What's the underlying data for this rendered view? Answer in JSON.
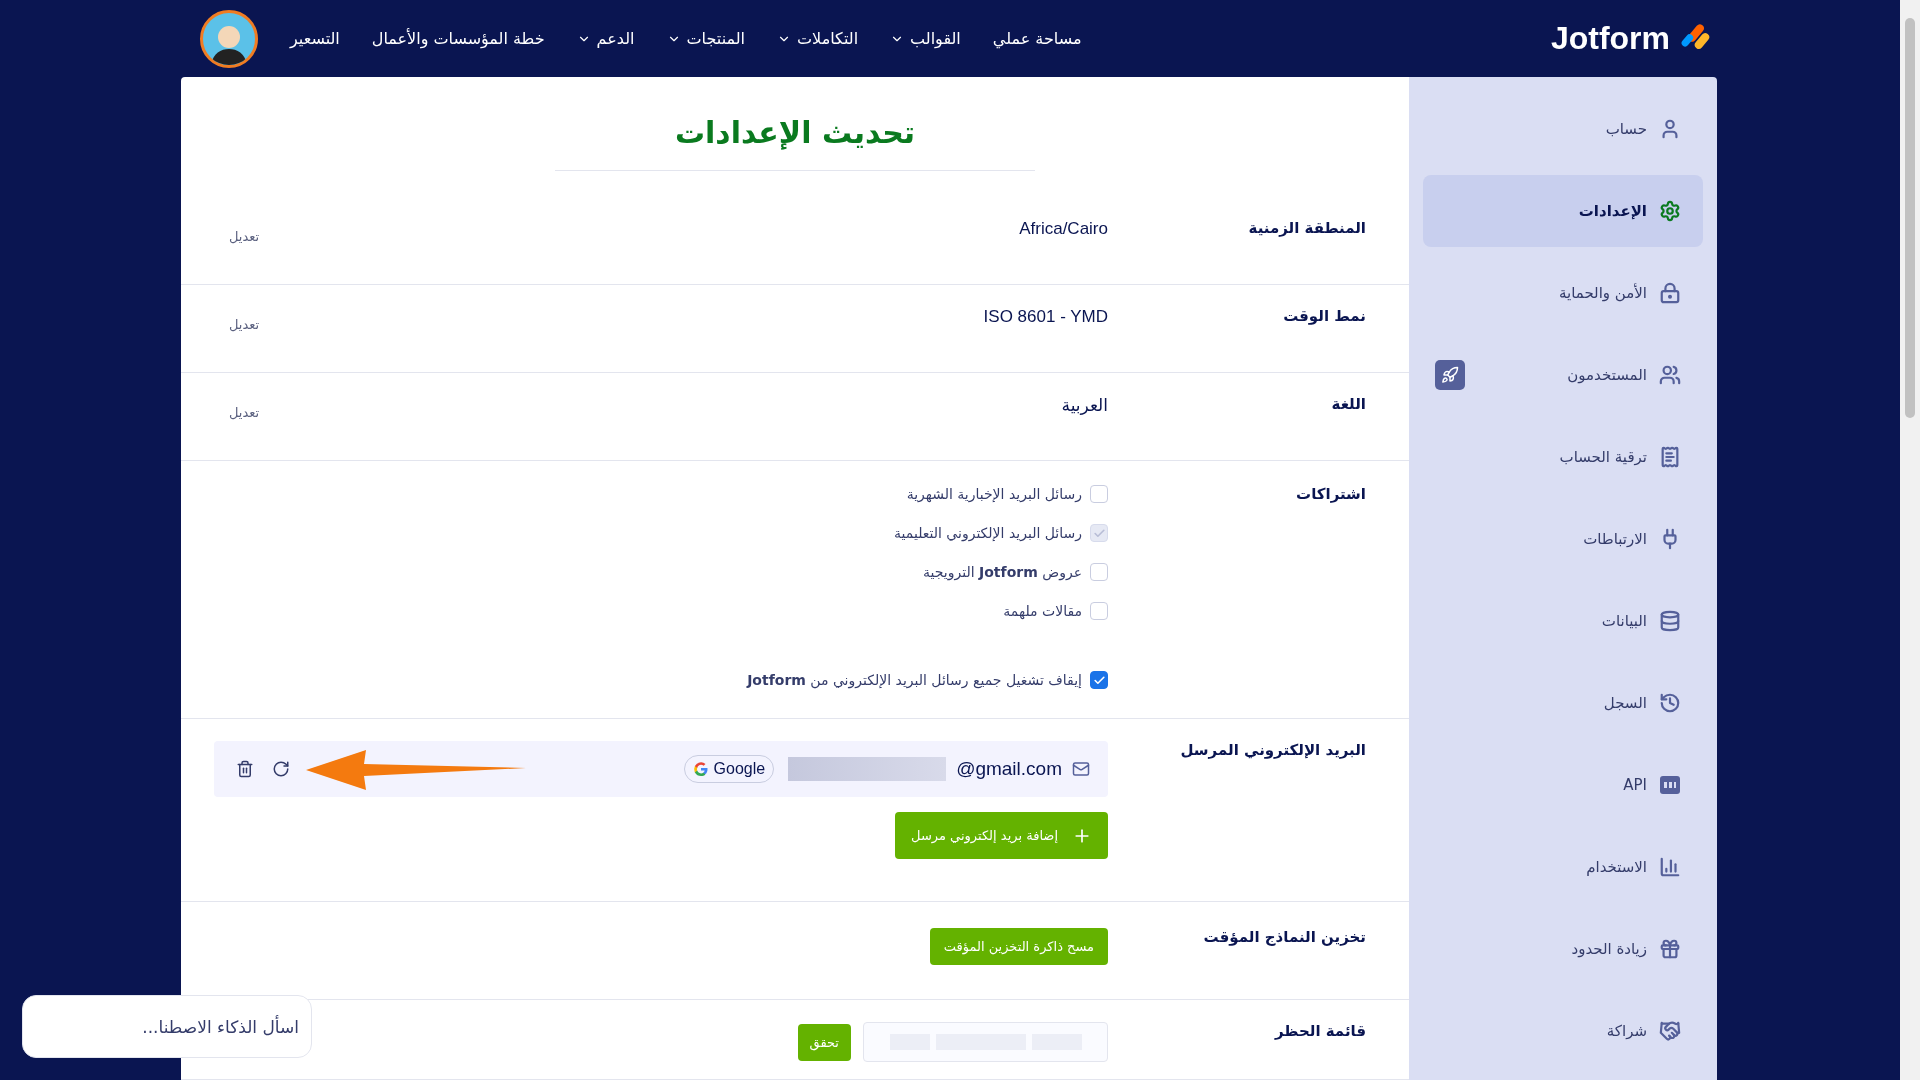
{
  "nav": {
    "logo": "Jotform",
    "items": [
      {
        "label": "مساحة عملي",
        "dropdown": false
      },
      {
        "label": "القوالب",
        "dropdown": true
      },
      {
        "label": "التكاملات",
        "dropdown": true
      },
      {
        "label": "المنتجات",
        "dropdown": true
      },
      {
        "label": "الدعم",
        "dropdown": true
      },
      {
        "label": "خطة المؤسسات والأعمال",
        "dropdown": false
      },
      {
        "label": "التسعير",
        "dropdown": false
      }
    ]
  },
  "sidebar": {
    "items": [
      {
        "label": "حساب",
        "selected": false
      },
      {
        "label": "الإعدادات",
        "selected": true
      },
      {
        "label": "الأمن والحماية",
        "selected": false
      },
      {
        "label": "المستخدمون",
        "selected": false
      },
      {
        "label": "ترقية الحساب",
        "selected": false
      },
      {
        "label": "الارتباطات",
        "selected": false
      },
      {
        "label": "البيانات",
        "selected": false
      },
      {
        "label": "السجل",
        "selected": false
      },
      {
        "label": "API",
        "selected": false
      },
      {
        "label": "الاستخدام",
        "selected": false
      },
      {
        "label": "زيادة الحدود",
        "selected": false
      },
      {
        "label": "شراكة",
        "selected": false
      }
    ]
  },
  "title": "تحديث الإعدادات",
  "settings": [
    {
      "kind": "value",
      "label": "المنطقة الزمنية",
      "value": "Africa/Cairo",
      "action": "تعديل"
    },
    {
      "kind": "value",
      "label": "نمط الوقت",
      "value": "ISO 8601 - YMD",
      "action": "تعديل"
    },
    {
      "kind": "value",
      "label": "اللغة",
      "value": "العربية",
      "action": "تعديل"
    },
    {
      "kind": "checkboxes",
      "label": "اشتراكات",
      "options": [
        {
          "label": "رسائل البريد الإخبارية الشهرية",
          "checked": false,
          "disabled": false
        },
        {
          "label": "رسائل البريد الإلكتروني التعليمية",
          "checked": true,
          "disabled": true
        },
        {
          "label": "عروض **Jotform** الترويجية",
          "checked": false,
          "disabled": false
        },
        {
          "label": "مقالات ملهمة",
          "checked": false,
          "disabled": false
        }
      ],
      "master": {
        "label": "إيقاف تشغيل جميع رسائل البريد الإلكتروني من **Jotform**",
        "checked": true,
        "disabled": false
      }
    },
    {
      "kind": "sender",
      "label": "البريد الإلكتروني المرسل",
      "email": "@gmail.com",
      "provider": "Google",
      "button": "إضافة بريد إلكتروني مرسل"
    },
    {
      "kind": "button",
      "label": "تخزين النماذج المؤقت",
      "button": "مسح ذاكرة التخزين المؤقت"
    },
    {
      "kind": "check",
      "label": "قائمة الحظر",
      "button": "تحقق"
    }
  ],
  "ai_chat": {
    "prompt": "اسأل الذكاء الاصطنا..."
  }
}
